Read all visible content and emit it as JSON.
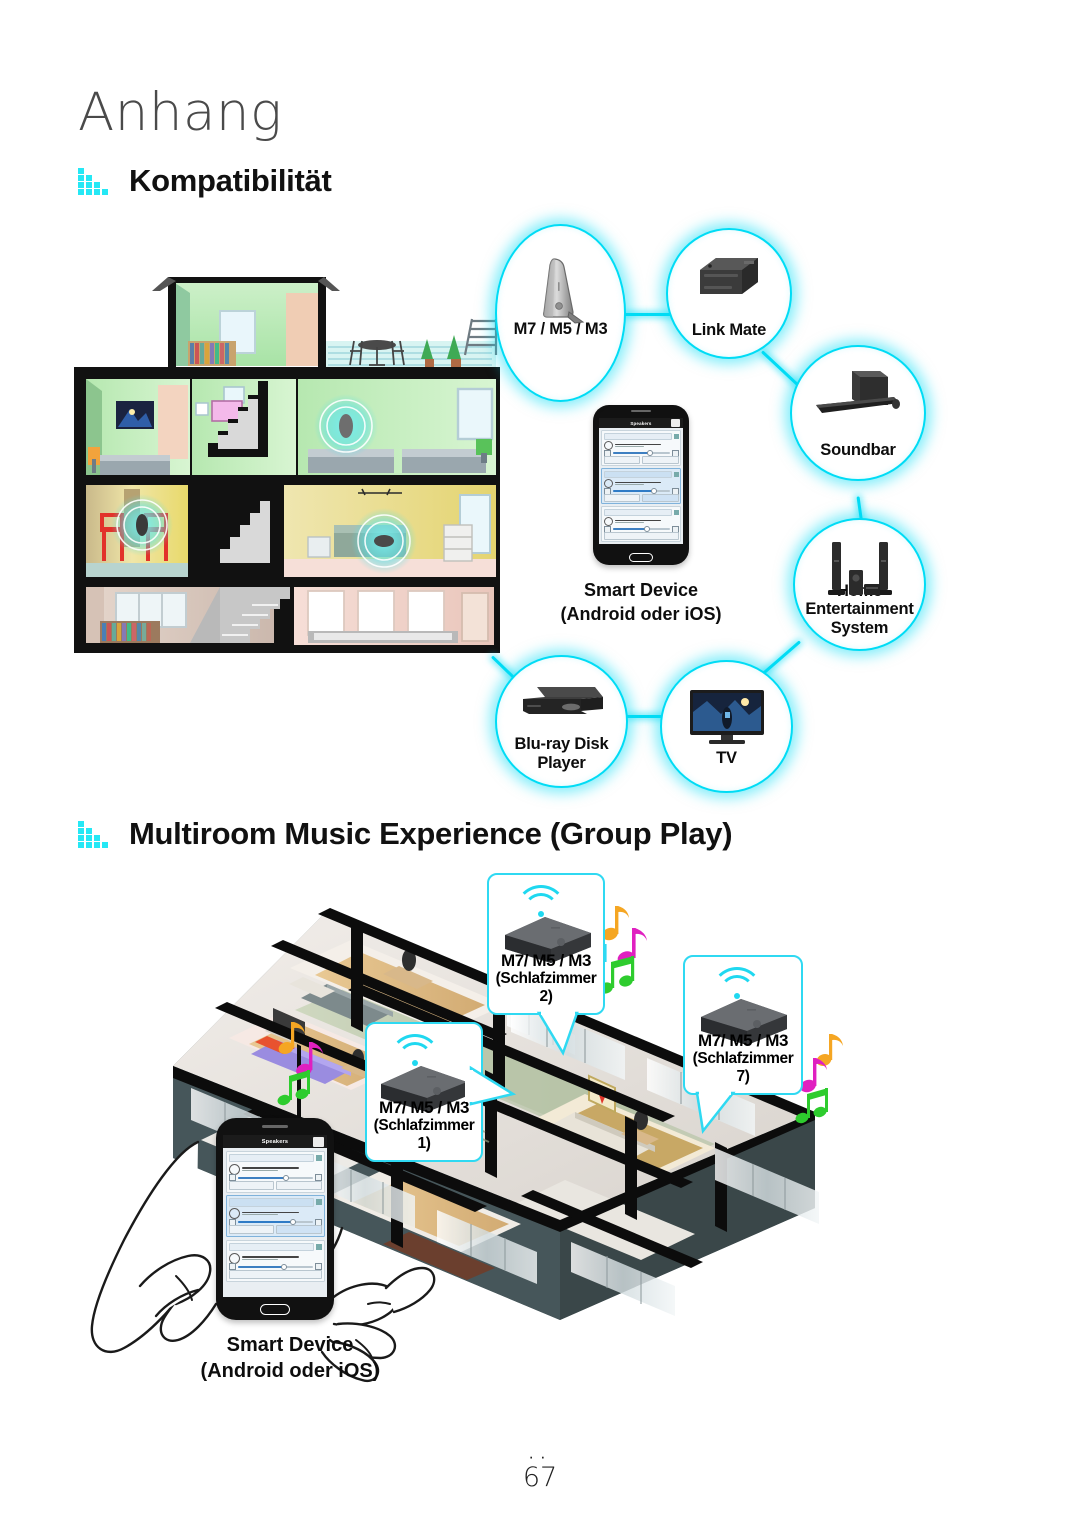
{
  "chapter": {
    "title": "Anhang"
  },
  "sections": [
    {
      "id": "compatibility",
      "label": "Kompatibilität",
      "icon": "equalizer-bars-icon"
    },
    {
      "id": "multiroom",
      "label": "Multiroom Music Experience (Group Play)",
      "icon": "equalizer-bars-icon"
    }
  ],
  "compatibility_diagram": {
    "house_illustration": "house-cutaway-illustration",
    "nodes": [
      {
        "id": "m7m5m3",
        "label": "M7 / M5 / M3",
        "icon": "wireless-speaker-icon"
      },
      {
        "id": "linkmate",
        "label": "Link Mate",
        "icon": "link-mate-icon"
      },
      {
        "id": "soundbar",
        "label": "Soundbar",
        "icon": "soundbar-icon"
      },
      {
        "id": "hes",
        "label": "Home Entertainment\nSystem",
        "icon": "home-theater-icon"
      },
      {
        "id": "tv",
        "label": "TV",
        "icon": "television-icon"
      },
      {
        "id": "bluray",
        "label": "Blu-ray Disk\nPlayer",
        "icon": "bluray-player-icon"
      }
    ],
    "center": {
      "id": "smart-device",
      "label_line1": "Smart Device",
      "label_line2": "(Android oder iOS)",
      "icon": "smartphone-icon"
    },
    "phone_app": {
      "title": "Speakers",
      "cards": [
        {
          "room": "Living Room",
          "track": "Don't Stop Loudly",
          "artist": "Glenn Morello",
          "selected": false,
          "btn_group": "Group",
          "btn_function": "Speaker Function"
        },
        {
          "room": "Bedroom 02",
          "track": "Singing In The Rain",
          "artist": "Gene Kelly",
          "selected": true,
          "btn_group": "Group",
          "btn_function": "Speaker Function"
        },
        {
          "room": "Bedroom 03",
          "track": "Don't Know Why",
          "artist": "Norah Jones",
          "selected": false,
          "btn_group": "Group",
          "btn_function": "Speaker Function"
        }
      ]
    }
  },
  "multiroom_diagram": {
    "floorplan_illustration": "isometric-apartment-floorplan",
    "callouts": [
      {
        "id": "bedroom1",
        "model": "M7/ M5 / M3",
        "room": "(Schlafzimmer 1)",
        "icon": "wireless-speaker-icon",
        "wifi": "wifi-icon"
      },
      {
        "id": "bedroom2",
        "model": "M7/ M5 / M3",
        "room": "(Schlafzimmer 2)",
        "icon": "wireless-speaker-icon",
        "wifi": "wifi-icon"
      },
      {
        "id": "bedroom7",
        "model": "M7/ M5 / M3",
        "room": "(Schlafzimmer 7)",
        "icon": "wireless-speaker-icon",
        "wifi": "wifi-icon"
      }
    ],
    "smart_device": {
      "label_line1": "Smart Device",
      "label_line2": "(Android oder iOS)",
      "icon": "smartphone-in-hands-icon"
    },
    "music_notes_colors": [
      "#F5A623",
      "#E020C0",
      "#2ECC2E",
      "#2FD9F2"
    ]
  },
  "footer": {
    "dots": "··",
    "page_number": "67"
  },
  "colors": {
    "accent_cyan": "#00DCF5",
    "callout_border": "#2FD9F2",
    "title_grey": "#4A4A4A",
    "text_black": "#0D0D0D"
  }
}
